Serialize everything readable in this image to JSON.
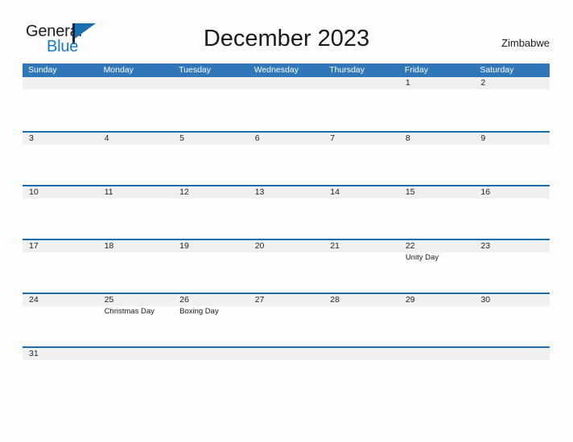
{
  "logo": {
    "word_one": "General",
    "word_two": "Blue",
    "flag_icon": "general-blue-flag-logo"
  },
  "header": {
    "title": "December 2023",
    "country": "Zimbabwe"
  },
  "calendar": {
    "colors": {
      "header_blue": "#2f77b8",
      "row_divider_blue": "#1c6cb0",
      "number_band_gray": "#f0f0f0",
      "page_background": "#fdfdfd",
      "logo_blue": "#1878c4"
    },
    "day_headers": [
      "Sunday",
      "Monday",
      "Tuesday",
      "Wednesday",
      "Thursday",
      "Friday",
      "Saturday"
    ],
    "weeks": [
      [
        {
          "day": "",
          "events": []
        },
        {
          "day": "",
          "events": []
        },
        {
          "day": "",
          "events": []
        },
        {
          "day": "",
          "events": []
        },
        {
          "day": "",
          "events": []
        },
        {
          "day": "1",
          "events": []
        },
        {
          "day": "2",
          "events": []
        }
      ],
      [
        {
          "day": "3",
          "events": []
        },
        {
          "day": "4",
          "events": []
        },
        {
          "day": "5",
          "events": []
        },
        {
          "day": "6",
          "events": []
        },
        {
          "day": "7",
          "events": []
        },
        {
          "day": "8",
          "events": []
        },
        {
          "day": "9",
          "events": []
        }
      ],
      [
        {
          "day": "10",
          "events": []
        },
        {
          "day": "11",
          "events": []
        },
        {
          "day": "12",
          "events": []
        },
        {
          "day": "13",
          "events": []
        },
        {
          "day": "14",
          "events": []
        },
        {
          "day": "15",
          "events": []
        },
        {
          "day": "16",
          "events": []
        }
      ],
      [
        {
          "day": "17",
          "events": []
        },
        {
          "day": "18",
          "events": []
        },
        {
          "day": "19",
          "events": []
        },
        {
          "day": "20",
          "events": []
        },
        {
          "day": "21",
          "events": []
        },
        {
          "day": "22",
          "events": [
            "Unity Day"
          ]
        },
        {
          "day": "23",
          "events": []
        }
      ],
      [
        {
          "day": "24",
          "events": []
        },
        {
          "day": "25",
          "events": [
            "Christmas Day"
          ]
        },
        {
          "day": "26",
          "events": [
            "Boxing Day"
          ]
        },
        {
          "day": "27",
          "events": []
        },
        {
          "day": "28",
          "events": []
        },
        {
          "day": "29",
          "events": []
        },
        {
          "day": "30",
          "events": []
        }
      ],
      [
        {
          "day": "31",
          "events": []
        },
        {
          "day": "",
          "events": []
        },
        {
          "day": "",
          "events": []
        },
        {
          "day": "",
          "events": []
        },
        {
          "day": "",
          "events": []
        },
        {
          "day": "",
          "events": []
        },
        {
          "day": "",
          "events": []
        }
      ]
    ]
  }
}
